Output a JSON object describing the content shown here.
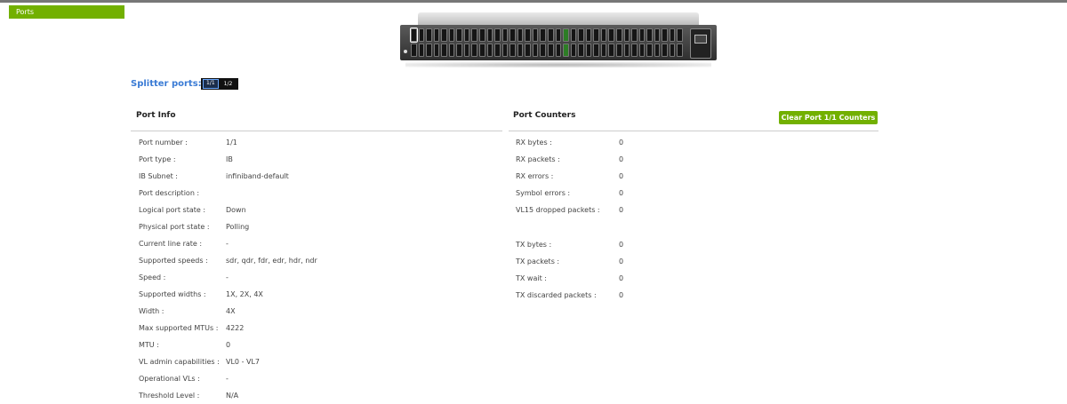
{
  "nav": {
    "ports_tab": "Ports"
  },
  "colors": {
    "accent": "#72b000",
    "splitter_label": "#3a7bd5",
    "rule": "#cccccc"
  },
  "splitter": {
    "label": "Splitter ports:",
    "options": [
      "1/1",
      "1/2"
    ],
    "selected": "1/1"
  },
  "port_info": {
    "title": "Port Info",
    "rows": [
      {
        "key": "Port number :",
        "value": "1/1"
      },
      {
        "key": "Port type :",
        "value": "IB"
      },
      {
        "key": "IB Subnet :",
        "value": "infiniband-default"
      },
      {
        "key": "Port description :",
        "value": ""
      },
      {
        "key": "Logical port state :",
        "value": "Down"
      },
      {
        "key": "Physical port state :",
        "value": "Polling"
      },
      {
        "key": "Current line rate :",
        "value": "-"
      },
      {
        "key": "Supported speeds :",
        "value": "sdr, qdr, fdr, edr, hdr, ndr"
      },
      {
        "key": "Speed :",
        "value": "-"
      },
      {
        "key": "Supported widths :",
        "value": "1X, 2X, 4X"
      },
      {
        "key": "Width :",
        "value": "4X"
      },
      {
        "key": "Max supported MTUs :",
        "value": "4222"
      },
      {
        "key": "MTU :",
        "value": "0"
      },
      {
        "key": "VL admin capabilities :",
        "value": "VL0 - VL7"
      },
      {
        "key": "Operational VLs :",
        "value": "-"
      },
      {
        "key": "Threshold Level :",
        "value": "N/A"
      }
    ]
  },
  "port_counters": {
    "title": "Port Counters",
    "clear_button": "Clear Port 1/1 Counters",
    "rx_rows": [
      {
        "key": "RX bytes :",
        "value": "0"
      },
      {
        "key": "RX packets :",
        "value": "0"
      },
      {
        "key": "RX errors :",
        "value": "0"
      },
      {
        "key": "Symbol errors :",
        "value": "0"
      },
      {
        "key": "VL15 dropped packets :",
        "value": "0"
      }
    ],
    "tx_rows": [
      {
        "key": "TX bytes :",
        "value": "0"
      },
      {
        "key": "TX packets :",
        "value": "0"
      },
      {
        "key": "TX wait :",
        "value": "0"
      },
      {
        "key": "TX discarded packets :",
        "value": "0"
      }
    ]
  },
  "switch": {
    "ports_per_row": 36,
    "rows": 2,
    "active_ports": [
      20,
      56
    ]
  }
}
